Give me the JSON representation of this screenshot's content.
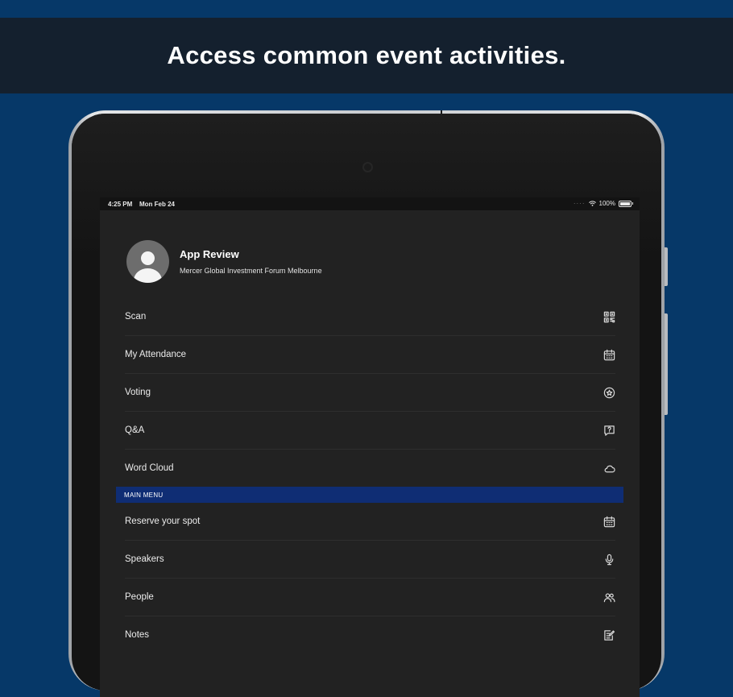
{
  "banner": {
    "title": "Access common event activities."
  },
  "status_bar": {
    "time": "4:25 PM",
    "date": "Mon Feb 24",
    "battery": "100%"
  },
  "profile": {
    "name": "App Review",
    "event": "Mercer Global Investment Forum Melbourne"
  },
  "menu_items": [
    {
      "label": "Scan",
      "icon": "qr-code-icon"
    },
    {
      "label": "My Attendance",
      "icon": "calendar-icon"
    },
    {
      "label": "Voting",
      "icon": "star-circle-icon"
    },
    {
      "label": "Q&A",
      "icon": "question-bubble-icon"
    },
    {
      "label": "Word Cloud",
      "icon": "cloud-icon"
    }
  ],
  "section": {
    "label": "MAIN MENU"
  },
  "main_menu_items": [
    {
      "label": "Reserve your spot",
      "icon": "calendar-icon"
    },
    {
      "label": "Speakers",
      "icon": "microphone-icon"
    },
    {
      "label": "People",
      "icon": "people-icon"
    },
    {
      "label": "Notes",
      "icon": "notes-icon"
    }
  ],
  "colors": {
    "background": "#063868",
    "banner": "#14202e",
    "screen": "#222222",
    "section_header": "#0f2d74"
  }
}
